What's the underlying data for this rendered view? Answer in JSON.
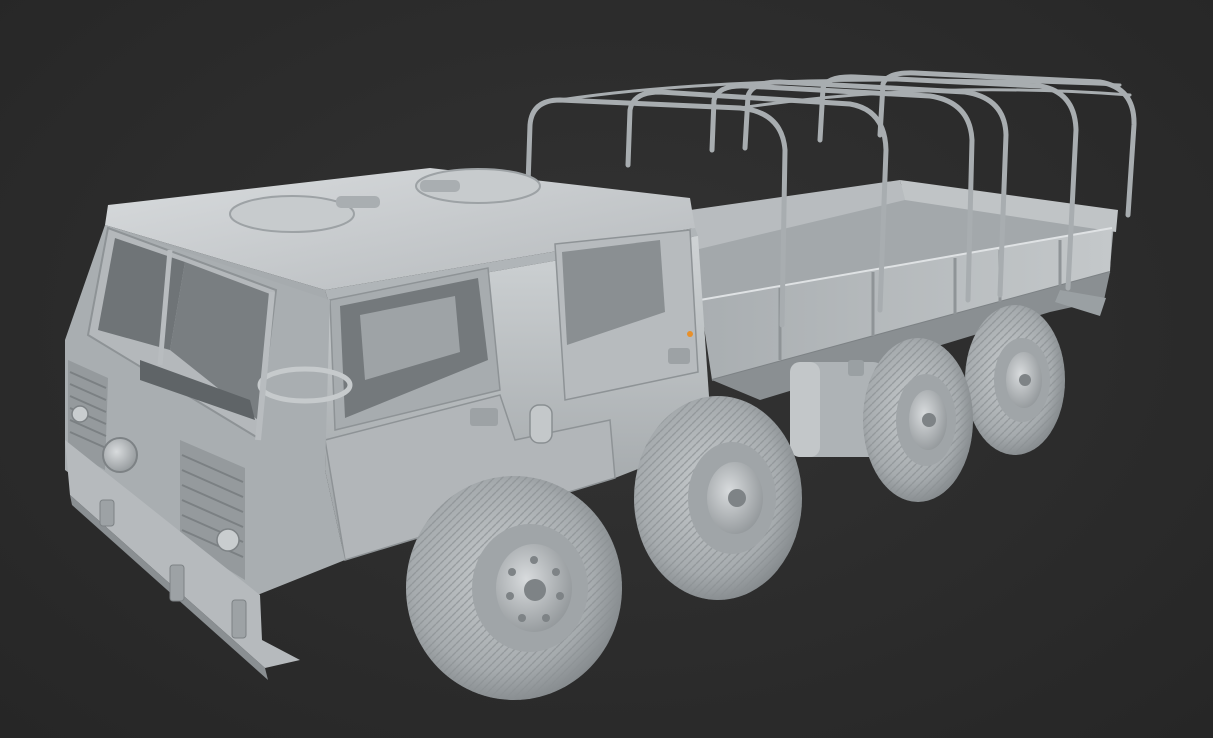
{
  "scene": {
    "subject": "truck-model",
    "background_color": "#2b2b2b",
    "clay_color": "#b9bdc0",
    "clay_shadow": "#7d8285",
    "clay_highlight": "#dfe2e4",
    "origin_marker_color": "#e8902a"
  }
}
